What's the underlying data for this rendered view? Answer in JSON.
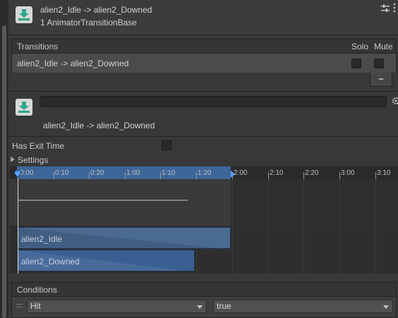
{
  "header": {
    "title": "alien2_Idle -> alien2_Downed",
    "subtitle": "1 AnimatorTransitionBase"
  },
  "transitions": {
    "label": "Transitions",
    "solo_label": "Solo",
    "mute_label": "Mute",
    "rows": [
      {
        "name": "alien2_Idle -> alien2_Downed",
        "solo": false,
        "mute": false
      }
    ],
    "remove_label": "−"
  },
  "transition": {
    "name_value": "",
    "display_name": "alien2_Idle -> alien2_Downed",
    "has_exit_time_label": "Has Exit Time",
    "has_exit_time": false,
    "settings_label": "Settings"
  },
  "timeline": {
    "ticks": [
      "0:00",
      "0:10",
      "0:20",
      "1:00",
      "1:10",
      "1:20",
      "2:00",
      "2:10",
      "2:20",
      "3:00",
      "3:10"
    ],
    "source_state": "alien2_Idle",
    "destination_state": "alien2_Downed"
  },
  "conditions": {
    "label": "Conditions",
    "items": [
      {
        "parameter": "Hit",
        "value": "true"
      }
    ]
  },
  "colors": {
    "accent": "#3d6699",
    "state_bar": "#4a6a92"
  }
}
